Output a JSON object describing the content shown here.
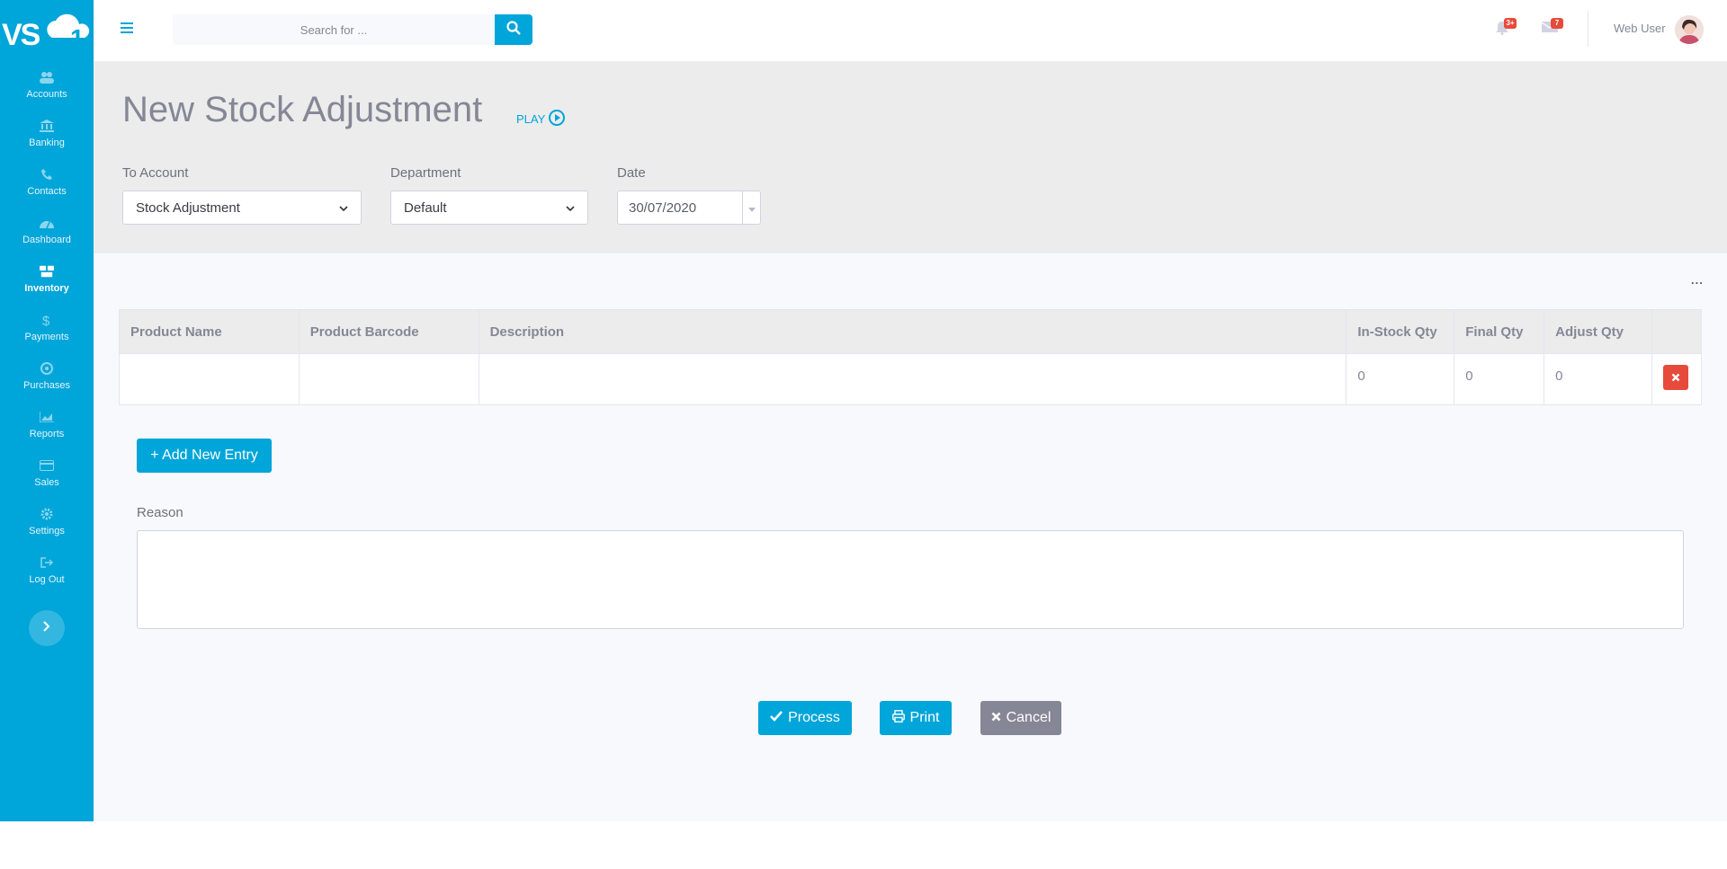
{
  "brand": {
    "logo_text": "VS1"
  },
  "sidebar": {
    "items": [
      {
        "label": "Accounts",
        "icon": "users-icon"
      },
      {
        "label": "Banking",
        "icon": "bank-icon"
      },
      {
        "label": "Contacts",
        "icon": "phone-icon"
      },
      {
        "label": "Dashboard",
        "icon": "gauge-icon"
      },
      {
        "label": "Inventory",
        "icon": "boxes-icon",
        "active": true
      },
      {
        "label": "Payments",
        "icon": "dollar-icon"
      },
      {
        "label": "Purchases",
        "icon": "coin-icon"
      },
      {
        "label": "Reports",
        "icon": "chart-icon"
      },
      {
        "label": "Sales",
        "icon": "card-icon"
      },
      {
        "label": "Settings",
        "icon": "gear-icon"
      },
      {
        "label": "Log Out",
        "icon": "logout-icon"
      }
    ]
  },
  "topbar": {
    "search_placeholder": "Search for ...",
    "notifications_badge": "3+",
    "messages_badge": "7",
    "user_name": "Web User"
  },
  "page": {
    "title": "New Stock Adjustment",
    "play_label": "PLAY",
    "to_account": {
      "label": "To Account",
      "value": "Stock Adjustment"
    },
    "department": {
      "label": "Department",
      "value": "Default"
    },
    "date": {
      "label": "Date",
      "value": "30/07/2020"
    }
  },
  "table": {
    "more": "...",
    "columns": [
      "Product Name",
      "Product Barcode",
      "Description",
      "In-Stock Qty",
      "Final Qty",
      "Adjust Qty"
    ],
    "rows": [
      {
        "product_name": "",
        "product_barcode": "",
        "description": "",
        "in_stock_qty": "0",
        "final_qty": "0",
        "adjust_qty": "0"
      }
    ]
  },
  "actions": {
    "add_entry": "+ Add New Entry",
    "reason_label": "Reason",
    "process": "Process",
    "print": "Print",
    "cancel": "Cancel"
  },
  "colors": {
    "primary": "#00a5d9",
    "danger": "#e74a3b",
    "gray": "#858796"
  }
}
